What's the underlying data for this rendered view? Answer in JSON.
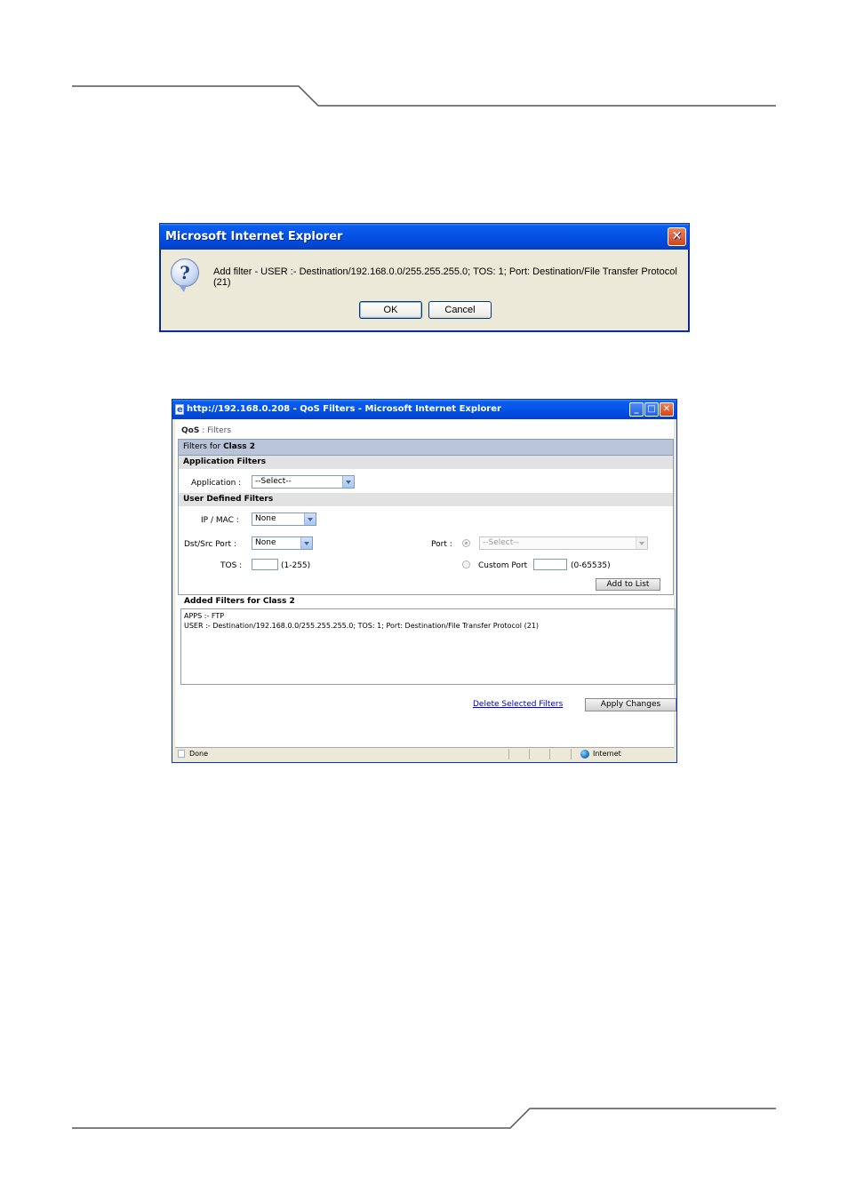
{
  "dialog": {
    "title": "Microsoft Internet Explorer",
    "message": "Add filter - USER :- Destination/192.168.0.0/255.255.255.0; TOS: 1; Port: Destination/File Transfer Protocol (21)",
    "ok_label": "OK",
    "cancel_label": "Cancel",
    "close_glyph": "✕",
    "icon": "question-icon",
    "icon_glyph": "?"
  },
  "ie": {
    "title": "http://192.168.0.208 - QoS Filters - Microsoft Internet Explorer",
    "minimize_glyph": "_",
    "maximize_glyph": "□",
    "close_glyph": "✕",
    "breadcrumb": {
      "root": "QoS",
      "sep": " : ",
      "page": "Filters"
    },
    "class_bar": {
      "prefix": "Filters for ",
      "class_name": "Class 2"
    },
    "app_filters": {
      "header": "Application Filters",
      "application_label": "Application :",
      "application_value": "--Select--"
    },
    "user_filters": {
      "header": "User Defined Filters",
      "ipmac_label": "IP / MAC :",
      "ipmac_value": "None",
      "dstsrc_label": "Dst/Src Port :",
      "dstsrc_value": "None",
      "tos_label": "TOS :",
      "tos_value": "",
      "tos_range": "(1-255)",
      "port_label": "Port :",
      "port_value": "--Select--",
      "custom_port_label": "Custom Port",
      "custom_port_value": "",
      "custom_port_range": "(0-65535)",
      "add_button": "Add to List"
    },
    "added": {
      "header": "Added Filters for Class 2",
      "items": [
        "APPS :- FTP",
        "USER :- Destination/192.168.0.0/255.255.255.0; TOS: 1; Port: Destination/File Transfer Protocol (21)"
      ]
    },
    "delete_link": "Delete Selected Filters",
    "apply_button": "Apply Changes",
    "status": {
      "left": "Done",
      "zone": "Internet"
    }
  }
}
